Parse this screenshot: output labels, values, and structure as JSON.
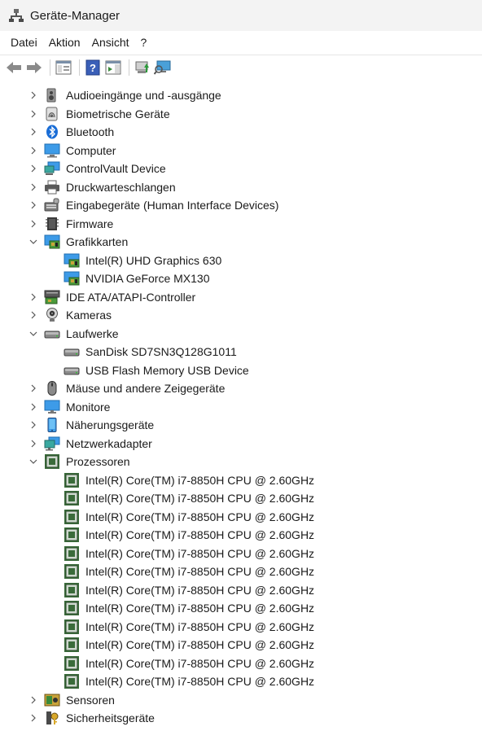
{
  "window": {
    "title": "Geräte-Manager"
  },
  "menu": [
    "Datei",
    "Aktion",
    "Ansicht",
    "?"
  ],
  "toolbar": [
    "back-icon",
    "forward-icon",
    "properties-pane-icon",
    "help-icon",
    "action-pane-icon",
    "update-driver-icon",
    "scan-hardware-icon"
  ],
  "tree": [
    {
      "label": "Audioeingänge und -ausgänge",
      "icon": "speaker-icon",
      "level": 0,
      "expanded": false
    },
    {
      "label": "Biometrische Geräte",
      "icon": "fingerprint-icon",
      "level": 0,
      "expanded": false
    },
    {
      "label": "Bluetooth",
      "icon": "bluetooth-icon",
      "level": 0,
      "expanded": false
    },
    {
      "label": "Computer",
      "icon": "computer-icon",
      "level": 0,
      "expanded": false
    },
    {
      "label": "ControlVault Device",
      "icon": "network-device-icon",
      "level": 0,
      "expanded": false
    },
    {
      "label": "Druckwarteschlangen",
      "icon": "printer-icon",
      "level": 0,
      "expanded": false
    },
    {
      "label": "Eingabegeräte (Human Interface Devices)",
      "icon": "hid-icon",
      "level": 0,
      "expanded": false
    },
    {
      "label": "Firmware",
      "icon": "firmware-icon",
      "level": 0,
      "expanded": false
    },
    {
      "label": "Grafikkarten",
      "icon": "display-adapter-icon",
      "level": 0,
      "expanded": true
    },
    {
      "label": "Intel(R) UHD Graphics 630",
      "icon": "display-adapter-icon",
      "level": 1
    },
    {
      "label": "NVIDIA GeForce MX130",
      "icon": "display-adapter-icon",
      "level": 1
    },
    {
      "label": "IDE ATA/ATAPI-Controller",
      "icon": "ide-controller-icon",
      "level": 0,
      "expanded": false
    },
    {
      "label": "Kameras",
      "icon": "webcam-icon",
      "level": 0,
      "expanded": false
    },
    {
      "label": "Laufwerke",
      "icon": "disk-drive-icon",
      "level": 0,
      "expanded": true
    },
    {
      "label": "SanDisk SD7SN3Q128G1011",
      "icon": "disk-drive-icon",
      "level": 1
    },
    {
      "label": "USB Flash Memory USB Device",
      "icon": "disk-drive-icon",
      "level": 1
    },
    {
      "label": "Mäuse und andere Zeigegeräte",
      "icon": "mouse-icon",
      "level": 0,
      "expanded": false
    },
    {
      "label": "Monitore",
      "icon": "monitor-icon",
      "level": 0,
      "expanded": false
    },
    {
      "label": "Näherungsgeräte",
      "icon": "proximity-device-icon",
      "level": 0,
      "expanded": false
    },
    {
      "label": "Netzwerkadapter",
      "icon": "network-adapter-icon",
      "level": 0,
      "expanded": false
    },
    {
      "label": "Prozessoren",
      "icon": "processor-icon",
      "level": 0,
      "expanded": true
    },
    {
      "label": "Intel(R) Core(TM) i7-8850H CPU @ 2.60GHz",
      "icon": "processor-icon",
      "level": 1
    },
    {
      "label": "Intel(R) Core(TM) i7-8850H CPU @ 2.60GHz",
      "icon": "processor-icon",
      "level": 1
    },
    {
      "label": "Intel(R) Core(TM) i7-8850H CPU @ 2.60GHz",
      "icon": "processor-icon",
      "level": 1
    },
    {
      "label": "Intel(R) Core(TM) i7-8850H CPU @ 2.60GHz",
      "icon": "processor-icon",
      "level": 1
    },
    {
      "label": "Intel(R) Core(TM) i7-8850H CPU @ 2.60GHz",
      "icon": "processor-icon",
      "level": 1
    },
    {
      "label": "Intel(R) Core(TM) i7-8850H CPU @ 2.60GHz",
      "icon": "processor-icon",
      "level": 1
    },
    {
      "label": "Intel(R) Core(TM) i7-8850H CPU @ 2.60GHz",
      "icon": "processor-icon",
      "level": 1
    },
    {
      "label": "Intel(R) Core(TM) i7-8850H CPU @ 2.60GHz",
      "icon": "processor-icon",
      "level": 1
    },
    {
      "label": "Intel(R) Core(TM) i7-8850H CPU @ 2.60GHz",
      "icon": "processor-icon",
      "level": 1
    },
    {
      "label": "Intel(R) Core(TM) i7-8850H CPU @ 2.60GHz",
      "icon": "processor-icon",
      "level": 1
    },
    {
      "label": "Intel(R) Core(TM) i7-8850H CPU @ 2.60GHz",
      "icon": "processor-icon",
      "level": 1
    },
    {
      "label": "Intel(R) Core(TM) i7-8850H CPU @ 2.60GHz",
      "icon": "processor-icon",
      "level": 1
    },
    {
      "label": "Sensoren",
      "icon": "sensor-icon",
      "level": 0,
      "expanded": false
    },
    {
      "label": "Sicherheitsgeräte",
      "icon": "security-device-icon",
      "level": 0,
      "expanded": false
    }
  ]
}
